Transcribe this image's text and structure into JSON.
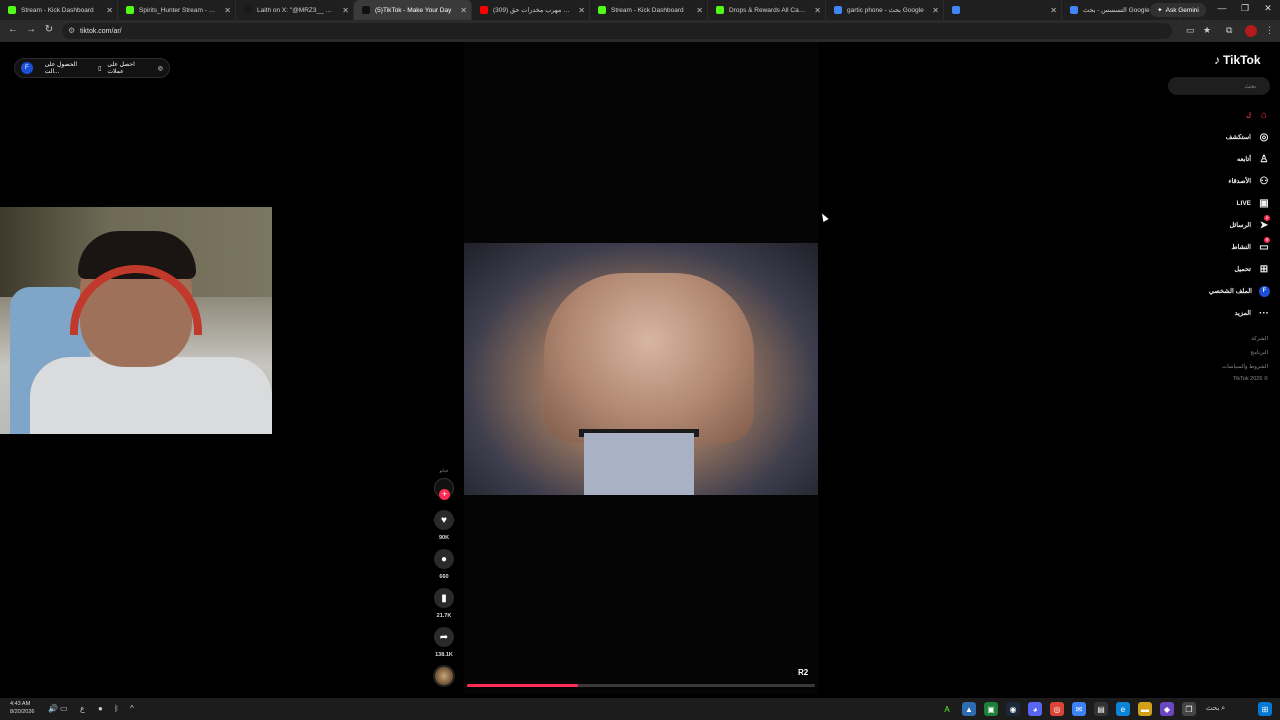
{
  "browser": {
    "tabs": [
      {
        "title": "Stream - Kick Dashboard",
        "color": "#53fc18"
      },
      {
        "title": "Spirits_Hunter Stream - Watch",
        "color": "#53fc18"
      },
      {
        "title": "Laith on X: \"@MRZ3__ @Auro",
        "color": "#1a1a1a"
      },
      {
        "title": "(5)TikTok - Make Your Day",
        "color": "#111111"
      },
      {
        "title": "(309) داهمت مهرب مخدرات حق...",
        "color": "#ff0000"
      },
      {
        "title": "Stream - Kick Dashboard",
        "color": "#53fc18"
      },
      {
        "title": "Drops & Rewards All Campaig",
        "color": "#53fc18"
      },
      {
        "title": "gartic phone - بحث Google",
        "color": "#4285f4"
      },
      {
        "title": "",
        "color": "#4285f4"
      },
      {
        "title": "التسسس - بحث Google",
        "color": "#4285f4"
      }
    ],
    "active_tab": 3,
    "gemini_label": "Ask Gemini",
    "url": "tiktok.com/ar/"
  },
  "page": {
    "get_coins": {
      "avatar_letter": "F",
      "coins_label": "احصل على عملات",
      "app_label": "الحصول على الت..."
    },
    "logo_text": "TikTok",
    "search_placeholder": "بحث",
    "nav": [
      {
        "label": "ل",
        "icon": "⌂",
        "active": true
      },
      {
        "label": "استكشف",
        "icon": "◎"
      },
      {
        "label": "أتابعه",
        "icon": "♙"
      },
      {
        "label": "الأصدقاء",
        "icon": "⚇"
      },
      {
        "label": "LIVE",
        "icon": "▣"
      },
      {
        "label": "الرسائل",
        "icon": "➤",
        "badge": "2"
      },
      {
        "label": "النشاط",
        "icon": "▭",
        "badge": "5"
      },
      {
        "label": "تحميل",
        "icon": "⊞"
      },
      {
        "label": "الملف الشخصي",
        "icon": "F"
      },
      {
        "label": "المزيد",
        "icon": "···"
      }
    ],
    "footer": [
      "الشركة",
      "البرنامج",
      "الشروط والسياسات",
      "TikTok 2026 ©"
    ],
    "video": {
      "creator_name": "حيانو",
      "likes": "90K",
      "comments": "660",
      "saves": "21.7K",
      "shares": "138.1K",
      "quality": "R2",
      "progress": 0.32
    }
  },
  "taskbar": {
    "time": "4:43 AM",
    "date": "8/20/2026",
    "lang": "ع",
    "search_label": "بحث"
  }
}
